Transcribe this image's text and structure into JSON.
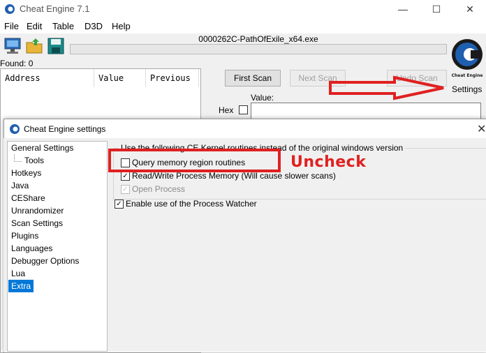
{
  "window": {
    "title": "Cheat Engine 7.1",
    "controls": [
      "—",
      "☐",
      "✕"
    ]
  },
  "menu": [
    "File",
    "Edit",
    "Table",
    "D3D",
    "Help"
  ],
  "process": {
    "name": "0000262C-PathOfExile_x64.exe"
  },
  "scan": {
    "found_label": "Found: 0",
    "columns": [
      "Address",
      "Value",
      "Previous"
    ],
    "first_scan": "First Scan",
    "next_scan": "Next Scan",
    "undo_scan": "Undo Scan",
    "value_label": "Value:",
    "hex_label": "Hex",
    "settings_label": "Settings"
  },
  "dialog": {
    "title": "Cheat Engine settings",
    "close": "✕",
    "tree": [
      {
        "label": "General Settings",
        "selected": false
      },
      {
        "label": "Tools",
        "selected": false,
        "child": true
      },
      {
        "label": "Hotkeys",
        "selected": false
      },
      {
        "label": "Java",
        "selected": false
      },
      {
        "label": "CEShare",
        "selected": false
      },
      {
        "label": "Unrandomizer",
        "selected": false
      },
      {
        "label": "Scan Settings",
        "selected": false
      },
      {
        "label": "Plugins",
        "selected": false
      },
      {
        "label": "Languages",
        "selected": false
      },
      {
        "label": "Debugger Options",
        "selected": false
      },
      {
        "label": "Lua",
        "selected": false
      },
      {
        "label": "Extra",
        "selected": true
      }
    ],
    "group_caption": "Use the following CE Kernel routines instead of the original windows version",
    "options": {
      "query_memory": {
        "label": "Query memory region routines",
        "checked": false
      },
      "rw_memory": {
        "label": "Read/Write Process Memory  (Will cause slower scans)",
        "checked": true
      },
      "open_process": {
        "label": "Open Process",
        "checked": true,
        "disabled": true
      },
      "process_watcher": {
        "label": "Enable use of the Process Watcher",
        "checked": true
      }
    }
  },
  "annotation": {
    "text": "Uncheck",
    "color": "#e02020"
  },
  "colors": {
    "selection": "#0078d7",
    "logo": "#1f5fb0"
  },
  "icons": [
    "cheat-engine-logo-icon",
    "computer-icon",
    "folder-open-icon",
    "save-disk-icon"
  ]
}
